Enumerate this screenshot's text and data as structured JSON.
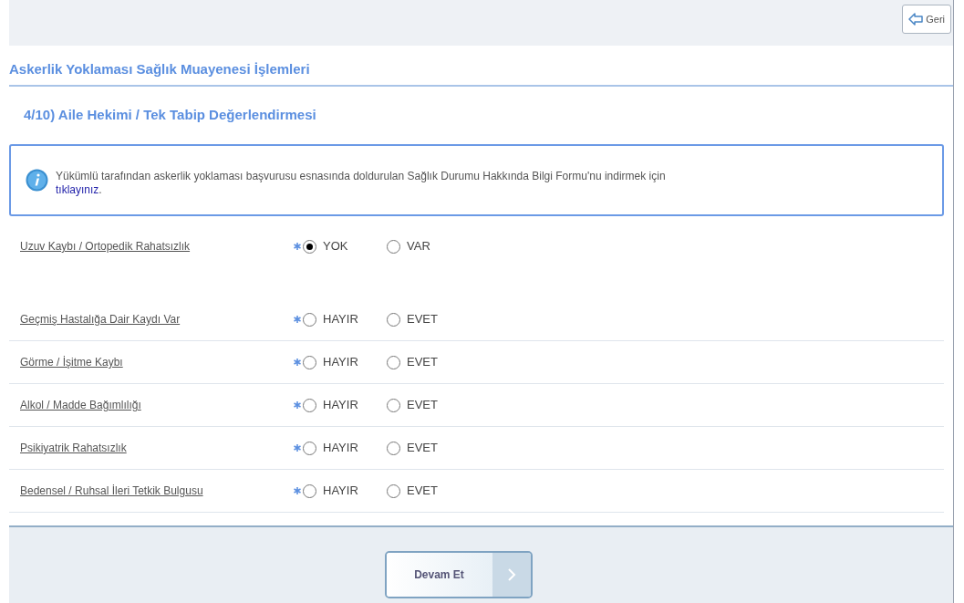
{
  "back_button": "Geri",
  "page_title": "Askerlik Yoklaması Sağlık Muayenesi İşlemleri",
  "section_title": "4/10) Aile Hekimi / Tek Tabip Değerlendirmesi",
  "info": {
    "text": "Yükümlü tarafından askerlik yoklaması başvurusu esnasında doldurulan Sağlık Durumu Hakkında Bilgi Formu'nu indirmek için",
    "link": "tıklayınız",
    "link_end": "."
  },
  "questions": [
    {
      "label": "Uzuv Kaybı / Ortopedik Rahatsızlık",
      "required": true,
      "options": [
        {
          "label": "YOK",
          "selected": true
        },
        {
          "label": "VAR",
          "selected": false
        }
      ]
    },
    {
      "label": "Geçmiş Hastalığa Dair Kaydı Var",
      "required": true,
      "options": [
        {
          "label": "HAYIR",
          "selected": false
        },
        {
          "label": "EVET",
          "selected": false
        }
      ]
    },
    {
      "label": "Görme / İşitme Kaybı",
      "required": true,
      "options": [
        {
          "label": "HAYIR",
          "selected": false
        },
        {
          "label": "EVET",
          "selected": false
        }
      ]
    },
    {
      "label": "Alkol / Madde Bağımlılığı",
      "required": true,
      "options": [
        {
          "label": "HAYIR",
          "selected": false
        },
        {
          "label": "EVET",
          "selected": false
        }
      ]
    },
    {
      "label": "Psikiyatrik Rahatsızlık",
      "required": true,
      "options": [
        {
          "label": "HAYIR",
          "selected": false
        },
        {
          "label": "EVET",
          "selected": false
        }
      ]
    },
    {
      "label": "Bedensel / Ruhsal İleri Tetkik Bulgusu",
      "required": true,
      "options": [
        {
          "label": "HAYIR",
          "selected": false
        },
        {
          "label": "EVET",
          "selected": false
        }
      ]
    }
  ],
  "continue_button": "Devam Et"
}
